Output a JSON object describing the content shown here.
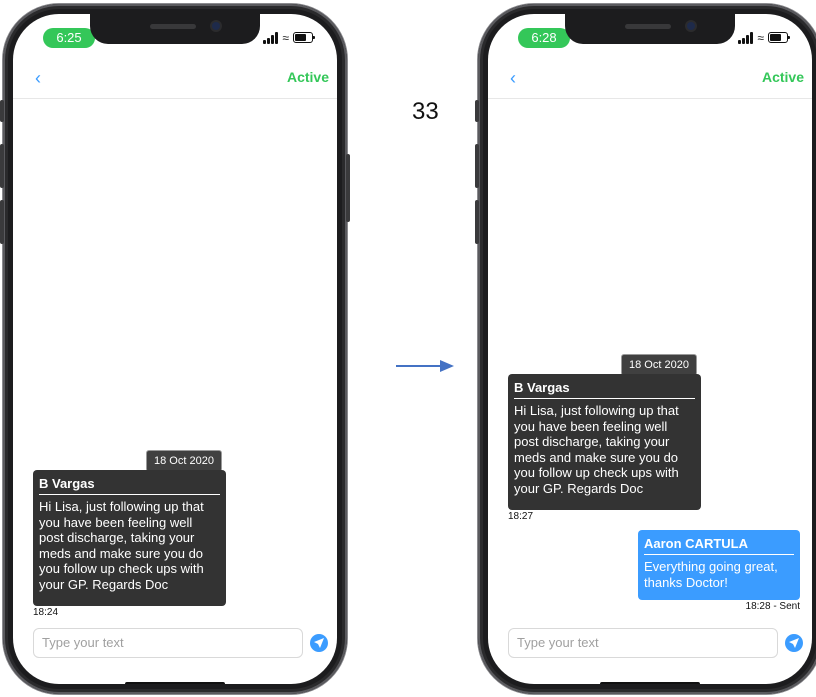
{
  "step_number": "33",
  "colors": {
    "accent_blue": "#3b9cff",
    "active_green": "#34c759",
    "incoming_bubble": "#333333"
  },
  "left_phone": {
    "status_time": "6:25",
    "nav": {
      "back_icon": "chevron-left-icon",
      "status": "Active"
    },
    "date_chip": "18 Oct 2020",
    "incoming": {
      "sender": "B Vargas",
      "text": "Hi Lisa, just following up that you have been feeling well post discharge, taking your meds and make sure you do you follow up check ups with your GP. Regards Doc",
      "time": "18:24"
    },
    "composer": {
      "placeholder": "Type your text",
      "send_icon": "paper-plane-icon"
    }
  },
  "right_phone": {
    "status_time": "6:28",
    "nav": {
      "back_icon": "chevron-left-icon",
      "status": "Active"
    },
    "date_chip": "18 Oct 2020",
    "incoming": {
      "sender": "B Vargas",
      "text": "Hi Lisa, just following up that you have been feeling well post discharge, taking your meds and make sure you do you follow up check ups with your GP. Regards Doc",
      "time": "18:27"
    },
    "outgoing": {
      "sender": "Aaron CARTULA",
      "text": "Everything going great, thanks Doctor!",
      "time": "18:28 - Sent"
    },
    "composer": {
      "placeholder": "Type your text",
      "send_icon": "paper-plane-icon"
    }
  }
}
